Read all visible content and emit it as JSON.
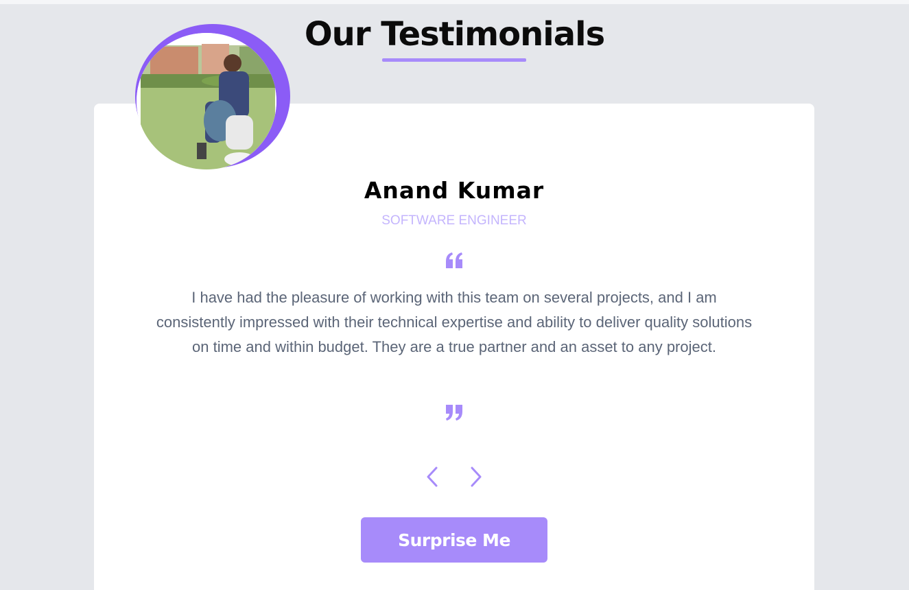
{
  "section": {
    "title": "Our Testimonials"
  },
  "testimonial": {
    "name": "Anand Kumar",
    "role": "Software Engineer",
    "text": "I have had the pleasure of working with this team on several projects, and I am consistently impressed with their technical expertise and ability to deliver quality solutions on time and within budget. They are a true partner and an asset to any project.",
    "avatar_icon": "person-photo"
  },
  "controls": {
    "prev_icon": "chevron-left-icon",
    "next_icon": "chevron-right-icon",
    "surprise_label": "Surprise Me"
  },
  "colors": {
    "accent": "#a78bfa",
    "accent_dark": "#8b5cf6",
    "role_text": "#c4b5fd",
    "body_text": "#5b6577",
    "background": "#e5e7eb",
    "card": "#ffffff"
  }
}
